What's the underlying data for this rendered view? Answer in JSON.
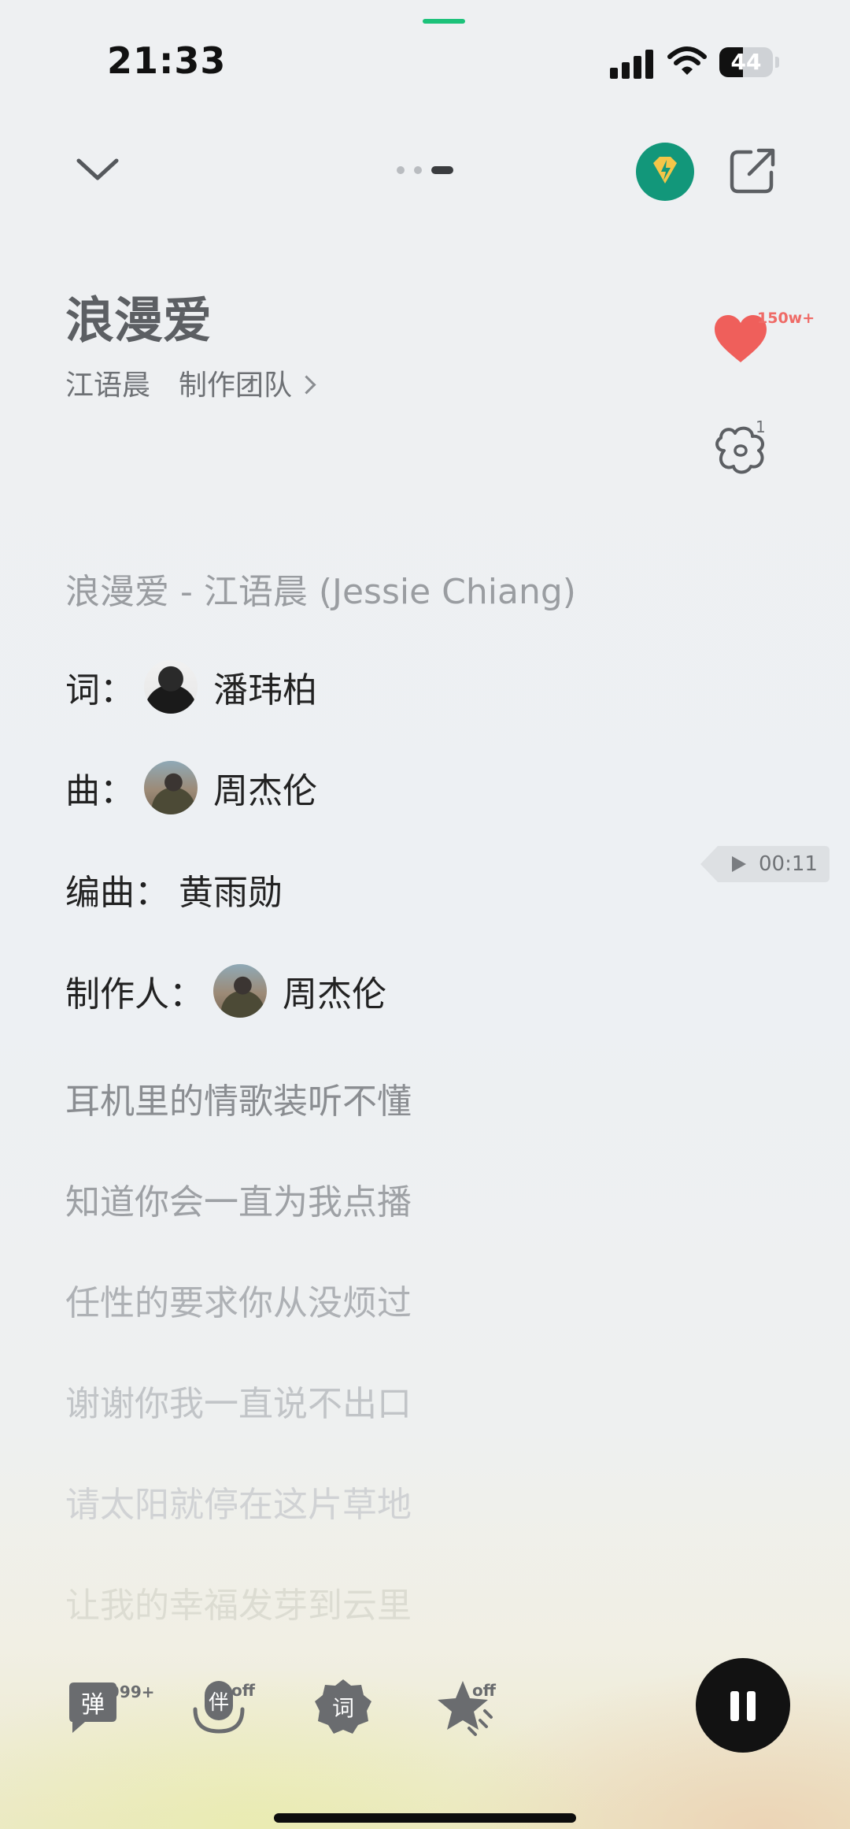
{
  "status_bar": {
    "time": "21:33",
    "battery": "44",
    "battery_level": 0.44
  },
  "header": {
    "dots": "page-indicator",
    "vip_icon": "diamond-bolt-icon",
    "share_icon": "share-icon"
  },
  "song": {
    "title": "浪漫爱",
    "artist": "江语晨",
    "team_link": "制作团队"
  },
  "actions": {
    "like_count": "150w+",
    "comment_count": "1"
  },
  "lyrics": {
    "header": "浪漫爱 - 江语晨 (Jessie Chiang)",
    "credits": [
      {
        "label": "词：",
        "name": "潘玮柏",
        "has_avatar": true
      },
      {
        "label": "曲：",
        "name": "周杰伦",
        "has_avatar": true
      },
      {
        "label": "编曲：",
        "name": "黄雨勋",
        "has_avatar": false
      },
      {
        "label": "制作人：",
        "name": "周杰伦",
        "has_avatar": true
      }
    ],
    "lines": [
      "耳机里的情歌装听不懂",
      "知道你会一直为我点播",
      "任性的要求你从没烦过",
      "谢谢你我一直说不出口",
      "请太阳就停在这片草地",
      "让我的幸福发芽到云里"
    ],
    "seek_time": "00:11"
  },
  "toolbar": {
    "danmaku_icon": "弹",
    "danmaku_count": "999+",
    "accompany_icon": "伴",
    "accompany_state": "off",
    "lyrics_icon": "词",
    "star_state": "off"
  },
  "colors": {
    "accent_green": "#1cc27a",
    "vip_green": "#12977a",
    "like_red": "#ef6b67"
  }
}
